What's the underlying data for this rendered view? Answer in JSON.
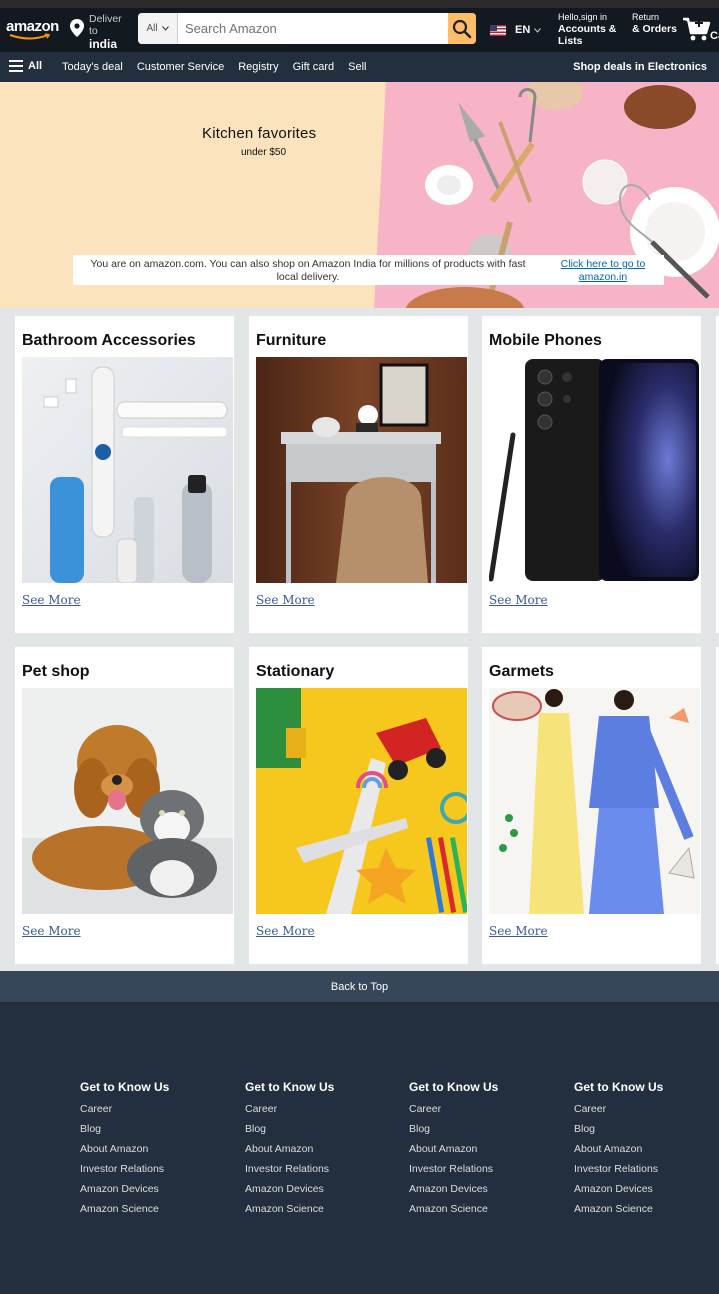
{
  "header": {
    "logo_text": "amazon",
    "deliver_line1": "Deliver to",
    "deliver_line2": "india",
    "search_category": "All",
    "search_placeholder": "Search Amazon",
    "language": "EN",
    "account_line1": "Hello,sign in",
    "account_line2": "Accounts & Lists",
    "returns_line1": "Return",
    "returns_line2": "& Orders",
    "cart_label": "Ca"
  },
  "nav": {
    "all_label": "All",
    "links": [
      "Today's deal",
      "Customer Service",
      "Registry",
      "Gift card",
      "Sell"
    ],
    "promo": "Shop deals in Electronics"
  },
  "hero": {
    "title": "Kitchen favorites",
    "subtitle": "under $50",
    "notice": "You are on amazon.com. You can also shop on Amazon India for millions of products with fast local delivery.",
    "notice_link": "Click here to go to amazon.in"
  },
  "categories": [
    {
      "title": "Bathroom Accessories",
      "link": "See More"
    },
    {
      "title": "Furniture",
      "link": "See More"
    },
    {
      "title": "Mobile Phones",
      "link": "See More"
    },
    {
      "title": "Pet shop",
      "link": "See More"
    },
    {
      "title": "Stationary",
      "link": "See More"
    },
    {
      "title": "Garmets",
      "link": "See More"
    }
  ],
  "back_to_top": "Back to Top",
  "footer": {
    "columns": [
      {
        "heading": "Get to Know Us",
        "items": [
          "Career",
          "Blog",
          "About Amazon",
          "Investor Relations",
          "Amazon Devices",
          "Amazon Science"
        ]
      },
      {
        "heading": "Get to Know Us",
        "items": [
          "Career",
          "Blog",
          "About Amazon",
          "Investor Relations",
          "Amazon Devices",
          "Amazon Science"
        ]
      },
      {
        "heading": "Get to Know Us",
        "items": [
          "Career",
          "Blog",
          "About Amazon",
          "Investor Relations",
          "Amazon Devices",
          "Amazon Science"
        ]
      },
      {
        "heading": "Get to Know Us",
        "items": [
          "Career",
          "Blog",
          "About Amazon",
          "Investor Relations",
          "Amazon Devices",
          "Amazon Science"
        ]
      }
    ]
  },
  "colors": {
    "header_bg": "#131921",
    "nav_bg": "#232f3e",
    "search_button": "#febd69",
    "link_blue": "#0066c0",
    "back_to_top_bg": "#37475a"
  }
}
